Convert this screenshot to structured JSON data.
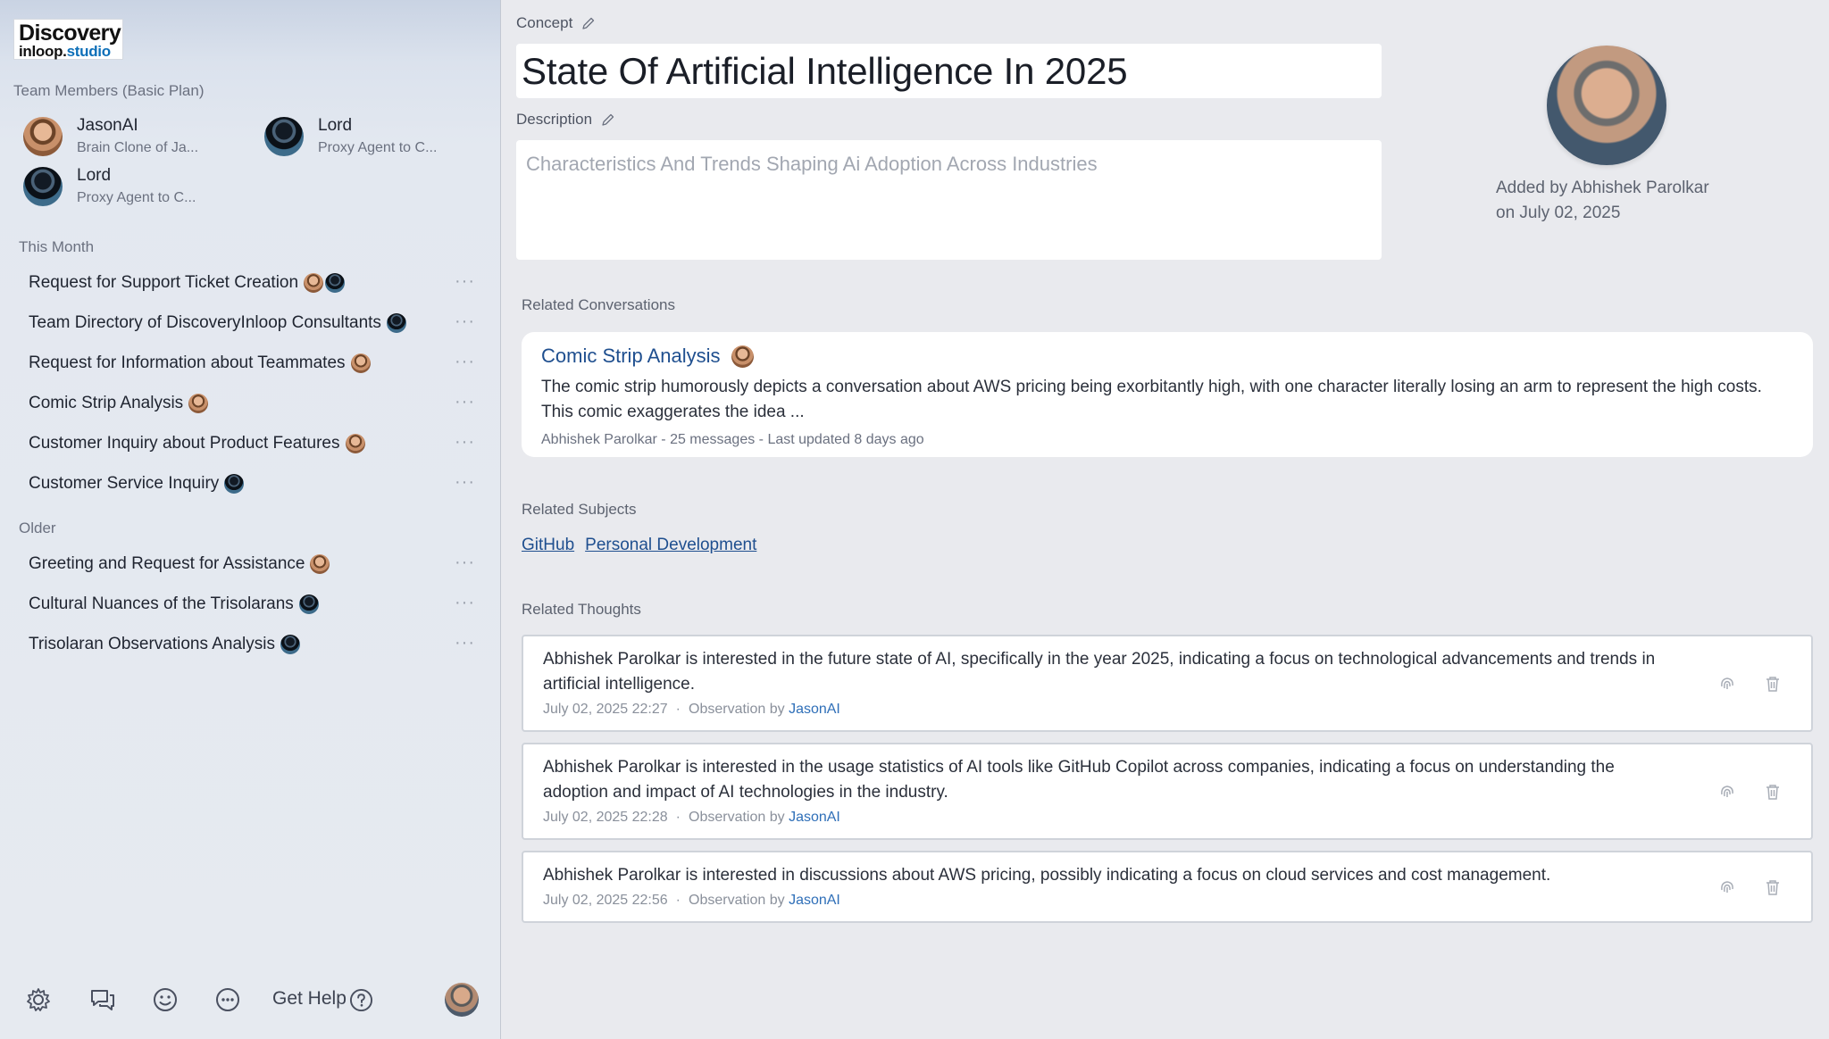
{
  "brand": {
    "line1": "Discovery",
    "line2_main": "inloop.",
    "line2_accent": "studio"
  },
  "sidebar": {
    "team_label": "Team Members (Basic Plan)",
    "members": [
      {
        "name": "JasonAI",
        "subtitle": "Brain Clone of Ja...",
        "avatar": "jason-avatar"
      },
      {
        "name": "Lord",
        "subtitle": "Proxy Agent to C...",
        "avatar": "lord-avatar"
      },
      {
        "name": "Lord",
        "subtitle": "Proxy Agent to C...",
        "avatar": "lord-avatar"
      }
    ],
    "this_month_label": "This Month",
    "this_month": [
      {
        "title": "Request for Support Ticket Creation"
      },
      {
        "title": "Team Directory of DiscoveryInloop Consultants"
      },
      {
        "title": "Request for Information about Teammates"
      },
      {
        "title": "Comic Strip Analysis"
      },
      {
        "title": "Customer Inquiry about Product Features"
      },
      {
        "title": "Customer Service Inquiry"
      }
    ],
    "older_label": "Older",
    "older": [
      {
        "title": "Greeting and Request for Assistance"
      },
      {
        "title": "Cultural Nuances of the Trisolarans"
      },
      {
        "title": "Trisolaran Observations Analysis"
      }
    ],
    "more_glyph": "···",
    "footer": {
      "help_label": "Get Help"
    }
  },
  "concept": {
    "label": "Concept",
    "title": "State Of Artificial Intelligence In 2025"
  },
  "description": {
    "label": "Description",
    "text": "Characteristics And Trends Shaping Ai Adoption Across Industries"
  },
  "added_by": {
    "line1": "Added by Abhishek Parolkar",
    "line2": "on July 02, 2025"
  },
  "related_conversations": {
    "label": "Related Conversations",
    "items": [
      {
        "title": "Comic Strip Analysis",
        "body": "The comic strip humorously depicts a conversation about AWS pricing being exorbitantly high, with one character literally losing an arm to represent the high costs. This comic exaggerates the idea ...",
        "meta": "Abhishek Parolkar - 25 messages - Last updated 8 days ago"
      }
    ]
  },
  "related_subjects": {
    "label": "Related Subjects",
    "items": [
      "GitHub",
      "Personal Development"
    ]
  },
  "related_thoughts": {
    "label": "Related Thoughts",
    "observation_prefix": "Observation by",
    "separator": "·",
    "items": [
      {
        "text": "Abhishek Parolkar is interested in the future state of AI, specifically in the year 2025, indicating a focus on technological advancements and trends in artificial intelligence.",
        "date": "July 02, 2025 22:27",
        "author": "JasonAI"
      },
      {
        "text": "Abhishek Parolkar is interested in the usage statistics of AI tools like GitHub Copilot across companies, indicating a focus on understanding the adoption and impact of AI technologies in the industry.",
        "date": "July 02, 2025 22:28",
        "author": "JasonAI"
      },
      {
        "text": "Abhishek Parolkar is interested in discussions about AWS pricing, possibly indicating a focus on cloud services and cost management.",
        "date": "July 02, 2025 22:56",
        "author": "JasonAI"
      }
    ]
  },
  "colors": {
    "link": "#1f4f8f",
    "observer": "#2f6fb8",
    "logo_accent": "#0d6fb8"
  }
}
